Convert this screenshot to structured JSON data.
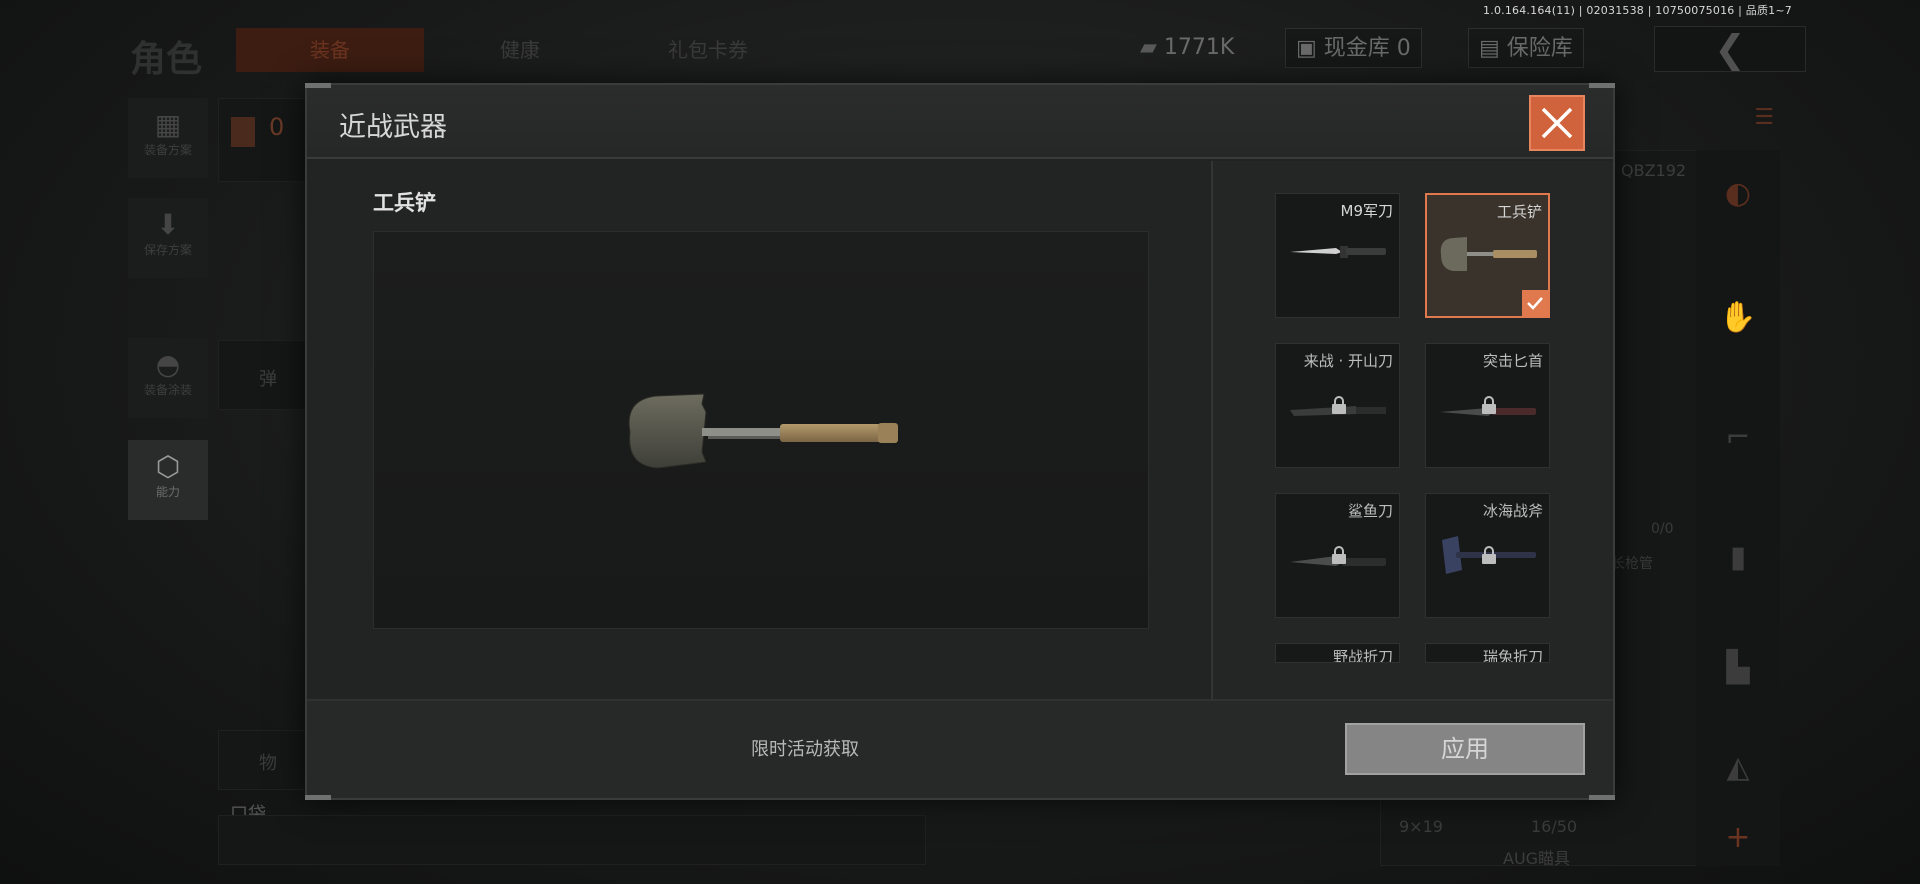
{
  "version": "1.0.164.164(11) | 02031538 | 10750075016 | 品质1~7",
  "topbar": {
    "title": "角色",
    "tabs": [
      {
        "label": "装备",
        "active": true
      },
      {
        "label": "健康",
        "active": false
      },
      {
        "label": "礼包卡券",
        "active": false
      }
    ],
    "currency": "1771K",
    "cash_vault": "现金库 0",
    "safe_vault": "保险库",
    "back_icon": "chevron-left-icon"
  },
  "sidebar": [
    {
      "label": "装备方案",
      "icon": "vest-icon"
    },
    {
      "label": "保存方案",
      "icon": "download-icon"
    },
    {
      "label": "装备涂装",
      "icon": "helmet-icon"
    },
    {
      "label": "能力",
      "icon": "ability-icon",
      "active": true
    }
  ],
  "background": {
    "count": "0",
    "ammo": "弹",
    "items": "物",
    "pocket": "口袋",
    "weapon_code": "QBZ192",
    "ammo_ratio": "0/0",
    "long_gun": "长枪管",
    "ammo_type": "9×19",
    "ammo_count": "16/50",
    "aug_label": "AUG瞄具"
  },
  "modal": {
    "title": "近战武器",
    "selected_name": "工兵铲",
    "footer_note": "限时活动获取",
    "apply_label": "应用",
    "weapons": [
      {
        "name": "M9军刀",
        "locked": false,
        "selected": false
      },
      {
        "name": "工兵铲",
        "locked": false,
        "selected": true
      },
      {
        "name": "来战 · 开山刀",
        "locked": true,
        "selected": false
      },
      {
        "name": "突击匕首",
        "locked": true,
        "selected": false
      },
      {
        "name": "鲨鱼刀",
        "locked": true,
        "selected": false
      },
      {
        "name": "冰海战斧",
        "locked": true,
        "selected": false
      },
      {
        "name": "野战折刀",
        "locked": true,
        "selected": false
      },
      {
        "name": "瑞兔折刀",
        "locked": true,
        "selected": false
      }
    ]
  },
  "colors": {
    "accent": "#e07a4e",
    "close_bg": "#d0633b",
    "apply_bg": "#858585"
  }
}
